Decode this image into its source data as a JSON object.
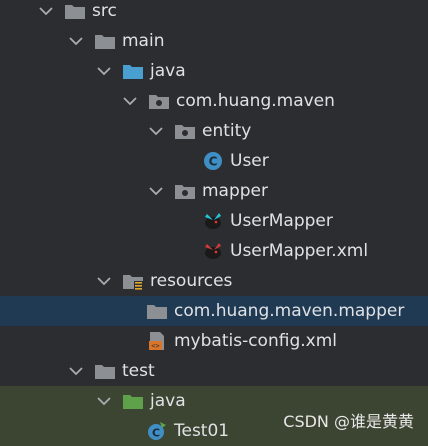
{
  "tree": {
    "src": "src",
    "main": "main",
    "java": "java",
    "package": "com.huang.maven",
    "entity": "entity",
    "user": "User",
    "mapper": "mapper",
    "user_mapper": "UserMapper",
    "user_mapper_xml": "UserMapper.xml",
    "resources": "resources",
    "resources_package": "com.huang.maven.mapper",
    "mybatis_config": "mybatis-config.xml",
    "test": "test",
    "test_java": "java",
    "test01": "Test01"
  },
  "watermark": "CSDN @谁是黄黄",
  "colors": {
    "background": "#2b2d30",
    "selected_row": "#1f3a52",
    "test_row": "#3c4532",
    "folder": "#8c8f94",
    "source_folder": "#4a9fd1",
    "test_folder": "#5fa14a",
    "class_icon": "#3f8fc4"
  }
}
